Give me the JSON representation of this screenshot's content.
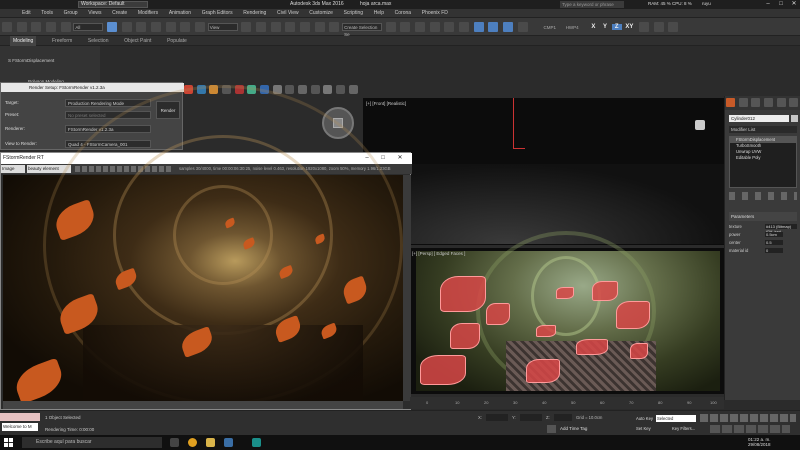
{
  "titlebar": {
    "workspace": "Workspace: Default",
    "app_title": "Autodesk 3ds Max 2016",
    "file": "hoja arca.max",
    "search_placeholder": "Type a keyword or phrase",
    "ram_cpu": "RAM: 45 %  CPU: 8 %",
    "user": "ruyu"
  },
  "menu": [
    "Edit",
    "Tools",
    "Group",
    "Views",
    "Create",
    "Modifiers",
    "Animation",
    "Graph Editors",
    "Rendering",
    "Civil View",
    "Customize",
    "Scripting",
    "Help",
    "Corona",
    "Phoenix FD"
  ],
  "toolbar": {
    "filter": "All",
    "view": "View",
    "selection_set": "Create Selection Se",
    "axis_x": "X",
    "axis_y": "Y",
    "axis_z": "Z",
    "axis_xy": "XY",
    "cmd1": "CMP1",
    "cmd2": "HWP4"
  },
  "ribbon": {
    "tabs": [
      "Modeling",
      "Freeform",
      "Selection",
      "Object Paint",
      "Populate"
    ],
    "active": "Modeling",
    "item1": "S FStormDisplacement",
    "item2": "Polygon Modeling"
  },
  "render_setup": {
    "title": "Render Setup: FStormRender v1.2.3a",
    "target_label": "Target:",
    "target_value": "Production Rendering Mode",
    "preset_label": "Preset:",
    "preset_value": "No preset selected",
    "renderer_label": "Renderer:",
    "renderer_value": "FStormRender v1.2.3a",
    "view_label": "View to Render:",
    "view_value": "Quad 4 - FStormCamera_001",
    "render_button": "Render"
  },
  "viewports": {
    "left_label": "[+] [Top] [ Wireframe ]",
    "top_label": "[+] [Front] [Realistic]",
    "bottom_label": "[+] [Persp] [ Edged Faces ]"
  },
  "frame_window": {
    "title": "FStormRender RT",
    "channel": "Image",
    "element": "beauty element",
    "stats": "samples 30/4000,  time 00:00:06:30:25,  noise level 0.463,  resolution 1920x1080,  zoom 50%,  memory 1.96/1.23GB"
  },
  "command_panel": {
    "object_name": "Cylinder012",
    "modifier_list": "Modifier List",
    "stack": [
      "FStormDisplacement",
      "TurboSmooth",
      "Unwrap UVW",
      "Editable Poly"
    ],
    "rollout": "Parameters",
    "params": [
      {
        "label": "texture",
        "value": "#413 (Bitmap) (Dif..jpg)"
      },
      {
        "label": "power",
        "value": "0.5cm"
      },
      {
        "label": "center",
        "value": "0.5"
      },
      {
        "label": "material id",
        "value": "0"
      }
    ]
  },
  "timeline": {
    "ticks": [
      "0",
      "10",
      "20",
      "30",
      "40",
      "50",
      "60",
      "70",
      "80",
      "90",
      "100"
    ]
  },
  "status": {
    "maxscript": "Welcome to M",
    "objects": "1 Object Selected",
    "render_time": "Rendering Time: 0:00:00",
    "x": "X:",
    "y": "Y:",
    "z": "Z:",
    "grid": "Grid = 10.0cm",
    "add_time_tag": "Add Time Tag",
    "auto_key": "Auto Key",
    "selected": "Selected",
    "set_key": "Set Key",
    "key_filters": "Key Filters..."
  },
  "taskbar": {
    "search": "Escribe aquí para buscar",
    "time": "01:22 a. m.",
    "date": "29/08/2018"
  }
}
